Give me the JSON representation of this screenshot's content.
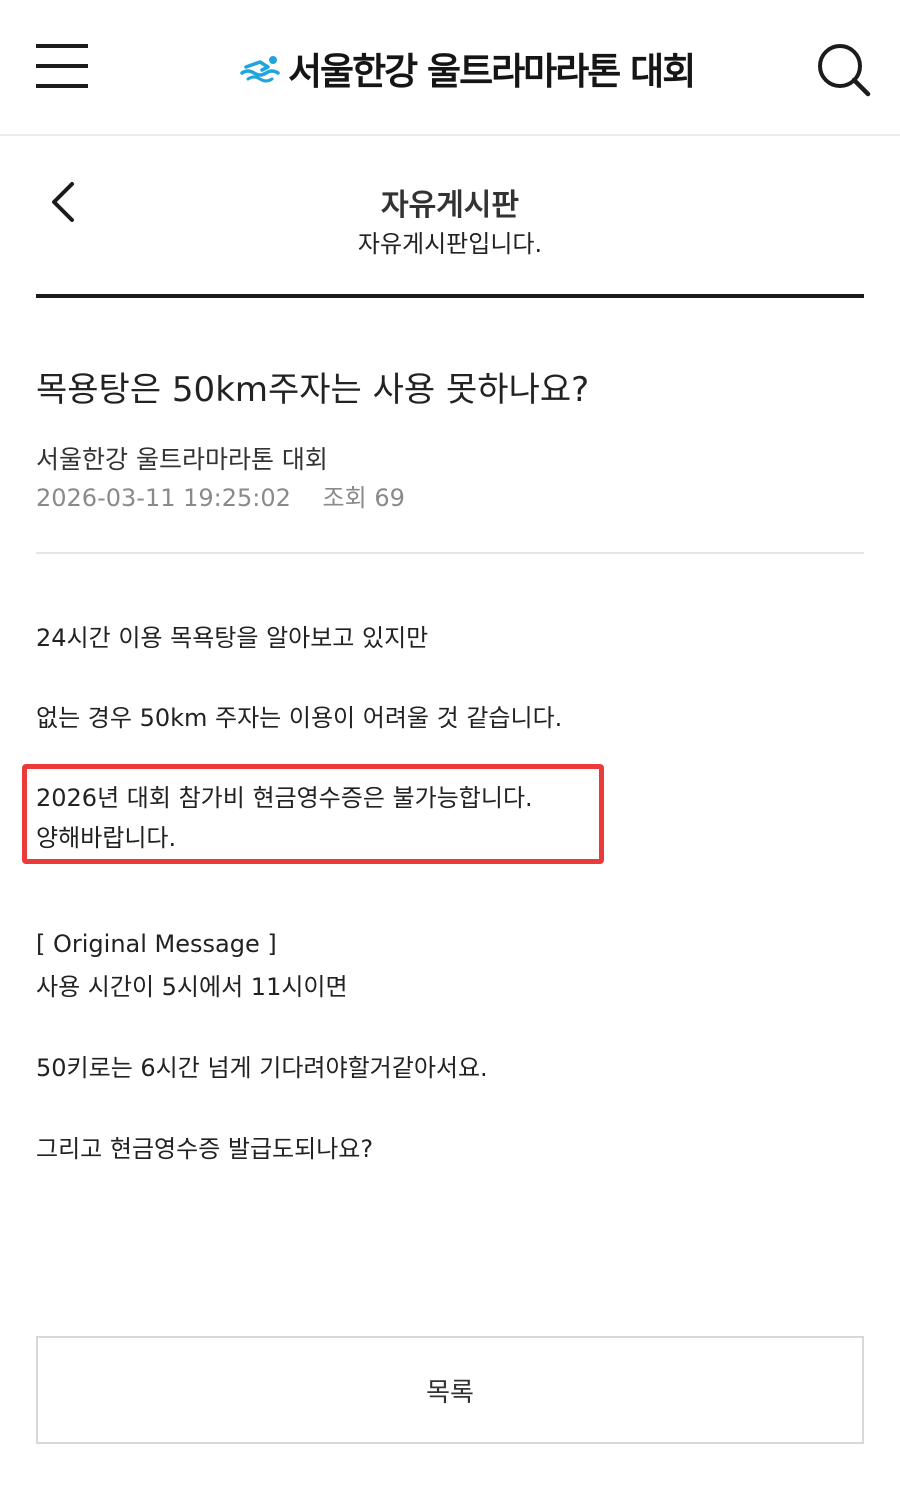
{
  "header": {
    "logo_text": "서울한강 울트라마라톤 대회",
    "menu_icon": "hamburger-menu-icon",
    "search_icon": "search-icon",
    "logo_icon": "swimmer-wave-logo-icon",
    "brand_color": "#1fa4dd"
  },
  "board": {
    "title": "자유게시판",
    "subtitle": "자유게시판입니다.",
    "back_icon": "chevron-left-icon"
  },
  "post": {
    "title": "목용탕은 50km주자는 사용 못하나요?",
    "author": "서울한강 울트라마라톤 대회",
    "datetime": "2026-03-11 19:25:02",
    "views_label": "조회 69",
    "body": {
      "line1": " 24시간 이용 목욕탕을 알아보고 있지만",
      "line2": "없는 경우 50km 주자는 이용이 어려울 것 같습니다.",
      "highlight_line1": "2026년 대회 참가비 현금영수증은 불가능합니다.",
      "highlight_line2": "양해바랍니다.",
      "highlight_color": "#ea3a3a",
      "quote_header": "[ Original Message ]",
      "quote_line1": "사용 시간이 5시에서 11시이면",
      "quote_line2": "50키로는 6시간 넘게 기다려야할거같아서요.",
      "quote_line3": "그리고 현금영수증 발급도되나요?"
    }
  },
  "footer": {
    "list_button": "목록"
  }
}
